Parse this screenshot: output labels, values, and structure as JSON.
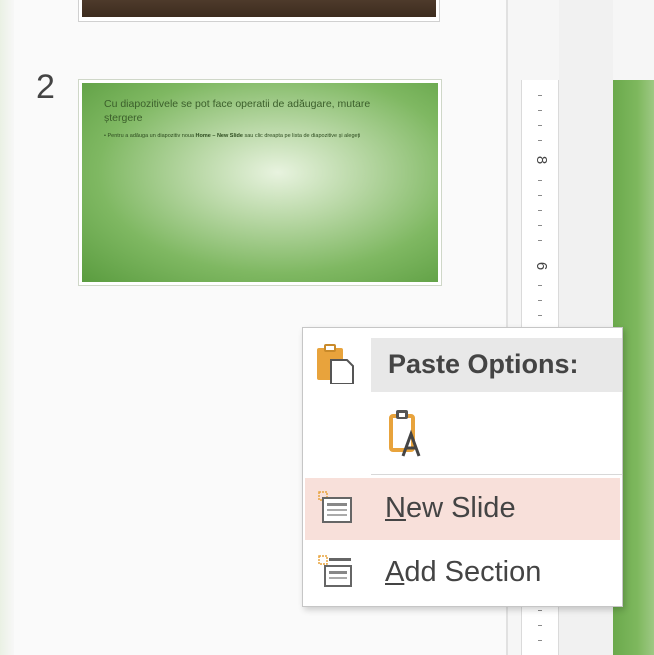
{
  "slides": [
    {
      "number": ""
    },
    {
      "number": "2",
      "title": "Cu diapozitivele se pot face operatii de adăugare, mutare ștergere",
      "bullet_pre": "Pentru a adăuga un diapozitiv noua ",
      "bullet_bold": "Home – New Slide",
      "bullet_post": " sau clic dreapta pe lista de diapozitive și alegeți"
    }
  ],
  "ruler": {
    "labels": [
      "8",
      "6"
    ]
  },
  "context_menu": {
    "paste_options_label": "Paste Options:",
    "items": [
      {
        "accel": "N",
        "rest": "ew Slide",
        "highlighted": true
      },
      {
        "accel": "A",
        "rest": "dd Section",
        "highlighted": false
      }
    ]
  },
  "colors": {
    "slide_green": "#7fb862",
    "menu_highlight": "#f8e0da",
    "icon_orange": "#e8a33c"
  },
  "icons": [
    "paste-clipboard-icon",
    "keep-text-only-icon",
    "new-slide-icon",
    "add-section-icon"
  ]
}
